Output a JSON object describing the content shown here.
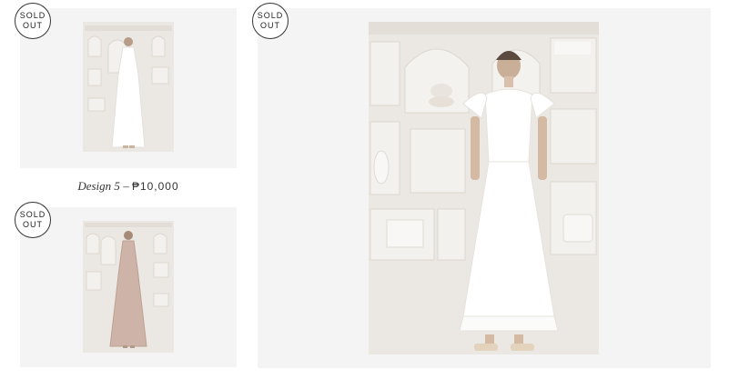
{
  "products": [
    {
      "badge_line1": "SOLD",
      "badge_line2": "OUT",
      "dress": "white sleeveless maxi dress"
    },
    {
      "badge_line1": "SOLD",
      "badge_line2": "OUT",
      "dress": "blush pink halter maxi dress"
    },
    {
      "badge_line1": "SOLD",
      "badge_line2": "OUT",
      "dress": "white ruffle-sleeve maxi dress"
    }
  ],
  "caption": {
    "name": "Design 5",
    "separator": "–",
    "price": "₱10,000"
  },
  "colors": {
    "card_bg": "#f4f4f4",
    "photo_bg": "#ece9e4",
    "white_dress": "#ffffff",
    "pink_dress": "#cdb3a8",
    "badge_border": "#333333"
  }
}
